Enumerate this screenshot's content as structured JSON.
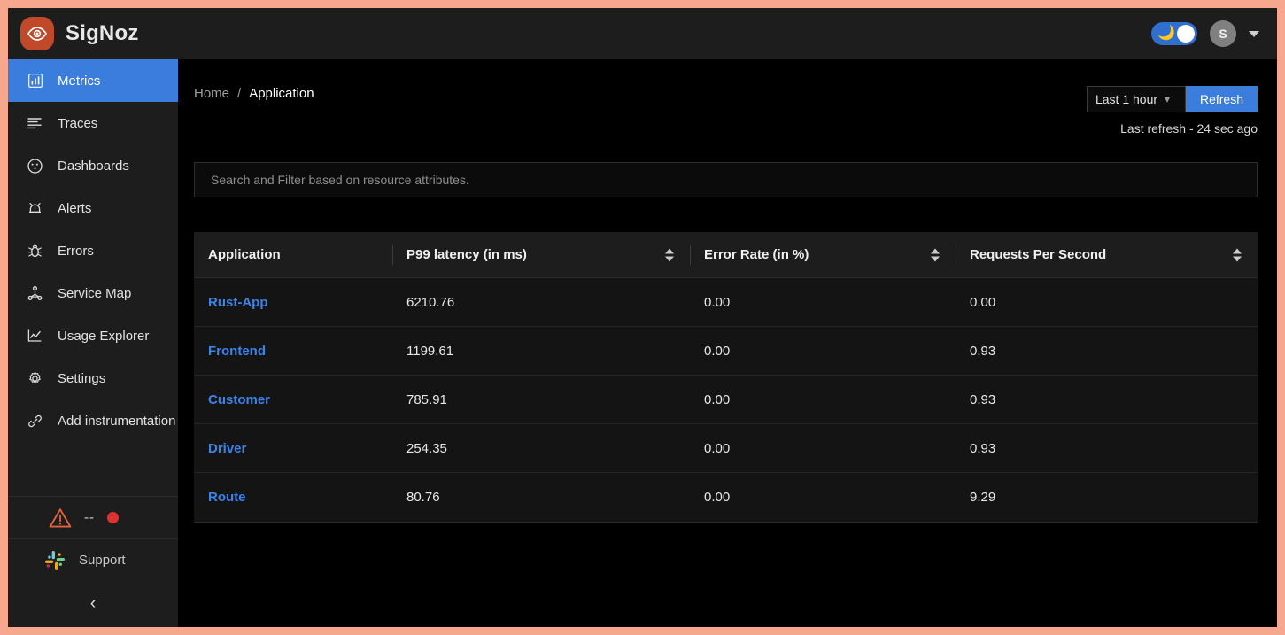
{
  "brand": {
    "name": "SigNoz",
    "logo_icon": "eye-icon"
  },
  "header": {
    "theme_toggle_icon": "moon-icon",
    "avatar_initial": "S",
    "account_caret_icon": "chevron-down-icon"
  },
  "sidebar": {
    "items": [
      {
        "label": "Metrics",
        "icon": "bar-chart-icon",
        "active": true
      },
      {
        "label": "Traces",
        "icon": "list-lines-icon",
        "active": false
      },
      {
        "label": "Dashboards",
        "icon": "gauge-icon",
        "active": false
      },
      {
        "label": "Alerts",
        "icon": "alarm-bell-icon",
        "active": false
      },
      {
        "label": "Errors",
        "icon": "bug-icon",
        "active": false
      },
      {
        "label": "Service Map",
        "icon": "node-graph-icon",
        "active": false
      },
      {
        "label": "Usage Explorer",
        "icon": "line-chart-icon",
        "active": false
      },
      {
        "label": "Settings",
        "icon": "gear-icon",
        "active": false
      },
      {
        "label": "Add instrumentation",
        "icon": "link-icon",
        "active": false
      }
    ],
    "status_row": {
      "warning_icon": "warning-triangle-icon",
      "label": "--",
      "status_dot_icon": "red-dot-icon"
    },
    "support": {
      "label": "Support",
      "icon": "slack-icon"
    },
    "collapse_icon": "chevron-left-icon"
  },
  "breadcrumb": {
    "home": "Home",
    "separator": "/",
    "current": "Application"
  },
  "timepicker": {
    "selected": "Last 1 hour",
    "chevron_icon": "chevron-down-icon",
    "refresh_label": "Refresh",
    "last_refresh": "Last refresh - 24 sec ago"
  },
  "search": {
    "placeholder": "Search and Filter based on resource attributes."
  },
  "table": {
    "columns": [
      {
        "label": "Application",
        "sortable": false
      },
      {
        "label": "P99 latency (in ms)",
        "sortable": true
      },
      {
        "label": "Error Rate (in %)",
        "sortable": true
      },
      {
        "label": "Requests Per Second",
        "sortable": true
      }
    ],
    "rows": [
      {
        "application": "Rust-App",
        "p99": "6210.76",
        "error_rate": "0.00",
        "rps": "0.00"
      },
      {
        "application": "Frontend",
        "p99": "1199.61",
        "error_rate": "0.00",
        "rps": "0.93"
      },
      {
        "application": "Customer",
        "p99": "785.91",
        "error_rate": "0.00",
        "rps": "0.93"
      },
      {
        "application": "Driver",
        "p99": "254.35",
        "error_rate": "0.00",
        "rps": "0.93"
      },
      {
        "application": "Route",
        "p99": "80.76",
        "error_rate": "0.00",
        "rps": "9.29"
      }
    ]
  },
  "colors": {
    "accent_blue": "#3b7ddd",
    "brand_orange": "#c0492a",
    "frame_border": "#f7a78d",
    "link_blue": "#3c83e8",
    "status_red": "#e03131"
  }
}
